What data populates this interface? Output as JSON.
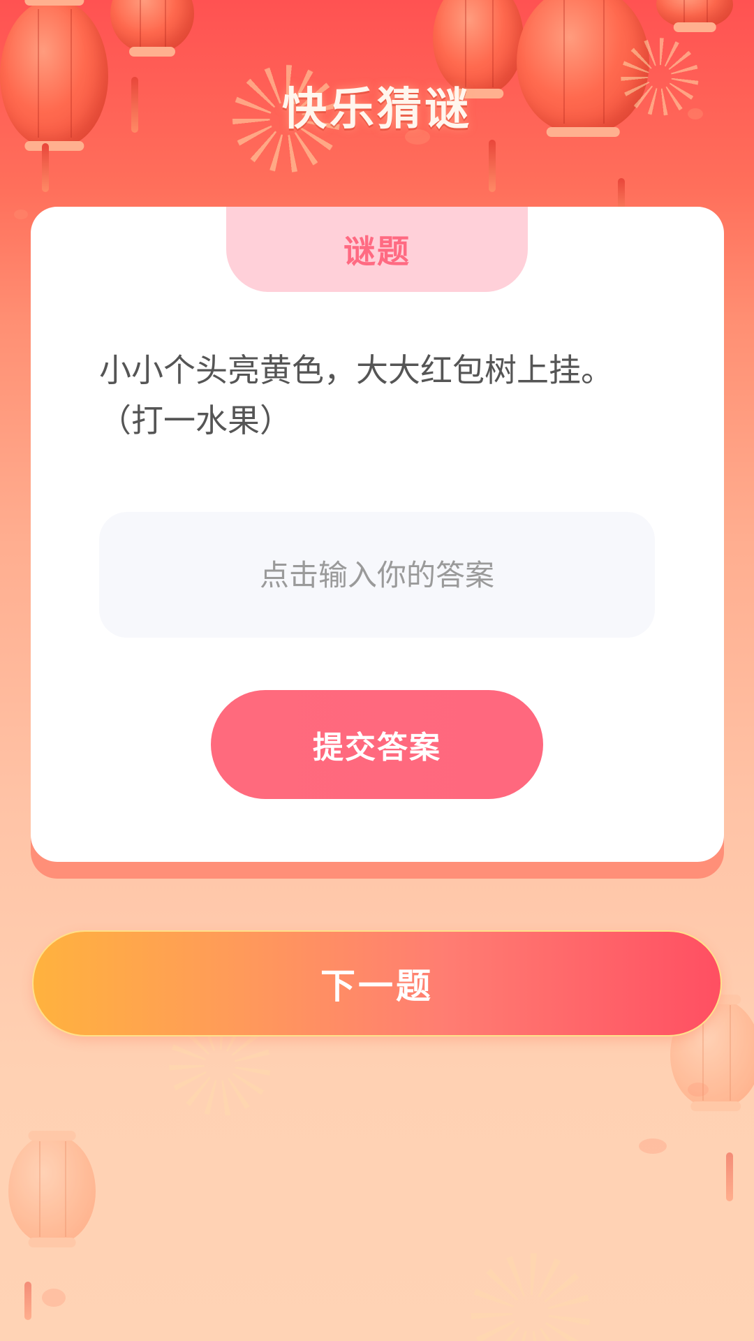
{
  "header": {
    "title": "快乐猜谜"
  },
  "card": {
    "tab_label": "谜题",
    "question": "小小个头亮黄色，大大红包树上挂。（打一水果）",
    "answer_input": {
      "value": "",
      "placeholder": "点击输入你的答案"
    },
    "submit_label": "提交答案"
  },
  "next_label": "下一题",
  "colors": {
    "accent_pink": "#ff6a7d",
    "tab_bg": "#ffd0d9",
    "next_gradient_start": "#ffb23e",
    "next_gradient_end": "#ff4f62"
  },
  "decorations": {
    "icons": [
      "lantern-icon",
      "firework-icon"
    ]
  }
}
